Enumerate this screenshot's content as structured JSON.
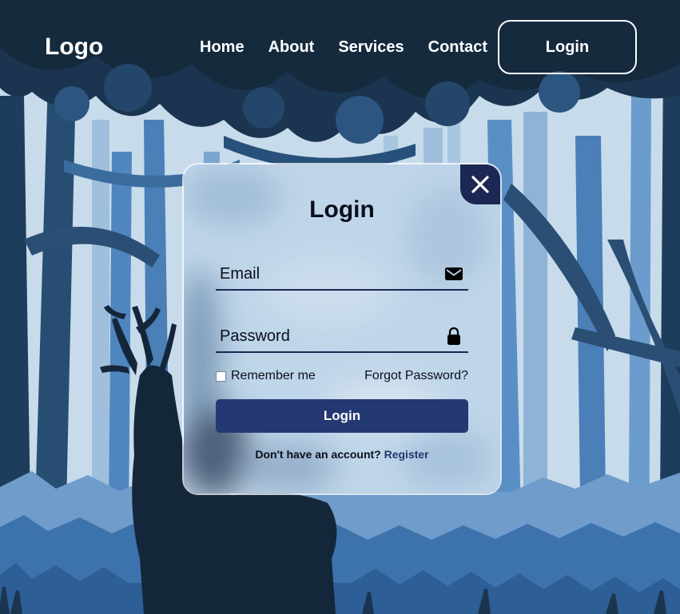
{
  "header": {
    "logo": "Logo",
    "nav": [
      {
        "label": "Home"
      },
      {
        "label": "About"
      },
      {
        "label": "Services"
      },
      {
        "label": "Contact"
      }
    ],
    "login_button": "Login"
  },
  "login_form": {
    "title": "Login",
    "email_placeholder": "Email",
    "email_value": "",
    "email_icon": "mail-icon",
    "password_placeholder": "Password",
    "password_value": "",
    "password_icon": "lock-icon",
    "remember_label": "Remember me",
    "remember_checked": false,
    "forgot_label": "Forgot Password?",
    "submit_label": "Login",
    "register_prompt": "Don't have an account?",
    "register_link": "Register",
    "close_icon": "close-icon"
  },
  "colors": {
    "navy": "#1c2854",
    "button": "#243873",
    "sky": "#c4d9ea",
    "forest_dark": "#162a3e",
    "forest_mid": "#3c6fa3"
  }
}
